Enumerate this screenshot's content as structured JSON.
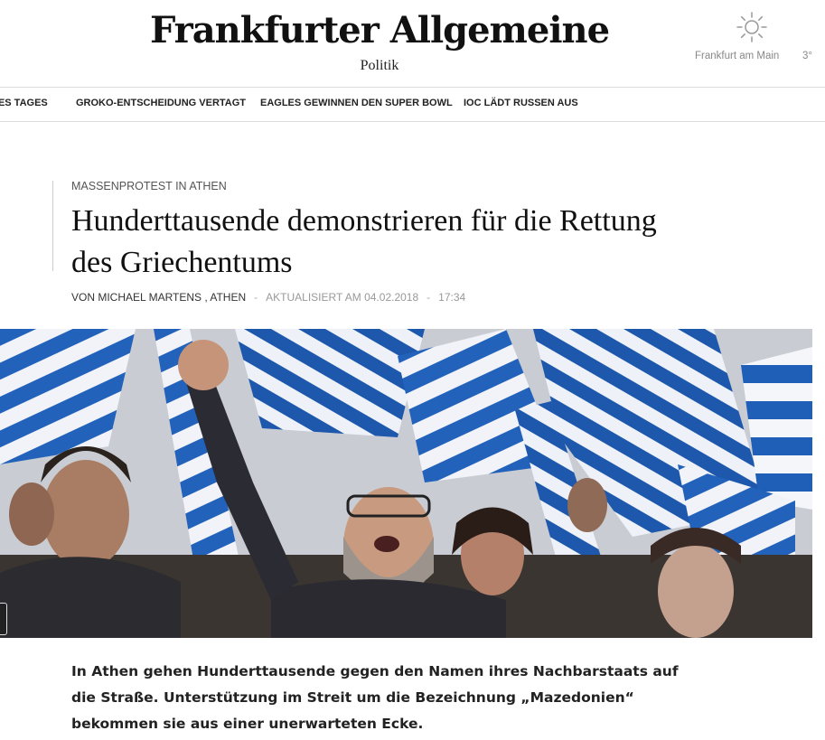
{
  "header": {
    "logo": "Frankfurter Allgemeine",
    "section": "Politik",
    "weather": {
      "icon": "sun-icon",
      "city": "Frankfurt am Main",
      "temp": "3°"
    }
  },
  "nav": {
    "items": [
      {
        "label": "DES TAGES"
      },
      {
        "label": "GROKO-ENTSCHEIDUNG VERTAGT"
      },
      {
        "label": "EAGLES GEWINNEN DEN SUPER BOWL"
      },
      {
        "label": "IOC LÄDT RUSSEN AUS"
      }
    ]
  },
  "article": {
    "kicker": "MASSENPROTEST IN ATHEN",
    "headline": "Hunderttausende demonstrieren für die Rettung des Griechentums",
    "byline": {
      "author": "VON MICHAEL MARTENS , ATHEN",
      "separator": "-",
      "updated": "AKTUALISIERT AM 04.02.2018",
      "time": "17:34"
    },
    "teaser": "In Athen gehen Hunderttausende gegen den Namen ihres Nachbarstaats auf die Straße. Unterstützung im Streit um die Bezeichnung „Mazedonien“ bekommen sie aus einer unerwarteten Ecke."
  },
  "colors": {
    "flag_blue": "#1f5fb8",
    "flag_white": "#f4f6fa",
    "text": "#222222",
    "muted": "#888888"
  }
}
